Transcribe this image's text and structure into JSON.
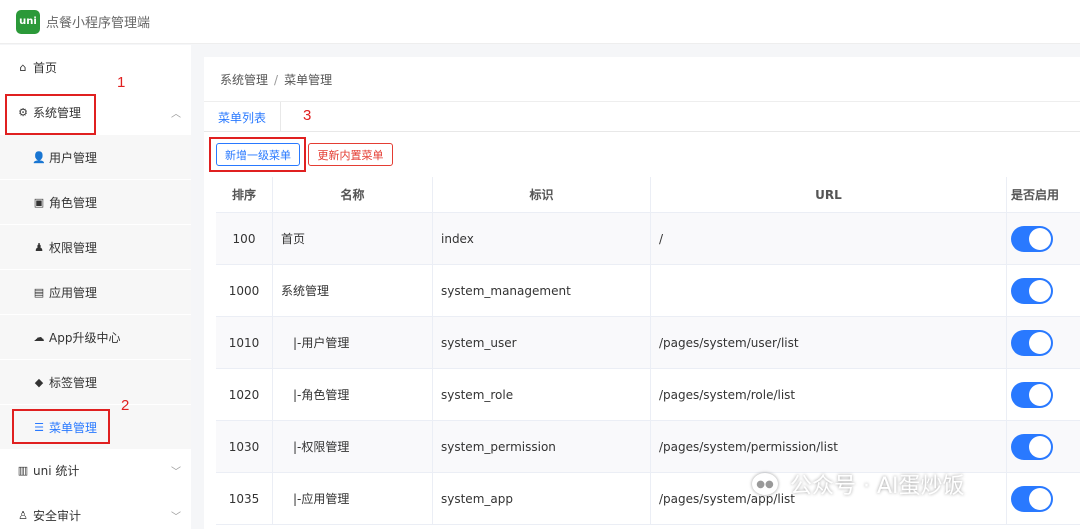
{
  "header": {
    "logo_text": "uni",
    "title": "点餐小程序管理端"
  },
  "sidebar": {
    "items": [
      {
        "label": "首页",
        "icon": "home-icon",
        "glyph": "⌂"
      },
      {
        "label": "系统管理",
        "icon": "gear-icon",
        "glyph": "⚙",
        "expanded": true
      },
      {
        "label": "用户管理",
        "icon": "user-icon",
        "glyph": "👤"
      },
      {
        "label": "角色管理",
        "icon": "role-icon",
        "glyph": "▣"
      },
      {
        "label": "权限管理",
        "icon": "permission-icon",
        "glyph": "♟"
      },
      {
        "label": "应用管理",
        "icon": "app-icon",
        "glyph": "▤"
      },
      {
        "label": "App升级中心",
        "icon": "cloud-upload-icon",
        "glyph": "☁"
      },
      {
        "label": "标签管理",
        "icon": "tag-icon",
        "glyph": "◆"
      },
      {
        "label": "菜单管理",
        "icon": "list-icon",
        "glyph": "☰",
        "active": true
      },
      {
        "label": "uni 统计",
        "icon": "stats-icon",
        "glyph": "▥"
      },
      {
        "label": "安全审计",
        "icon": "audit-icon",
        "glyph": "♙"
      }
    ]
  },
  "breadcrumb": {
    "level1": "系统管理",
    "separator": "/",
    "level2": "菜单管理"
  },
  "tabs": {
    "menu_list": "菜单列表"
  },
  "buttons": {
    "add_top_menu": "新增一级菜单",
    "update_builtin": "更新内置菜单"
  },
  "table": {
    "headers": {
      "order": "排序",
      "name": "名称",
      "id": "标识",
      "url": "URL",
      "enabled": "是否启用"
    },
    "rows": [
      {
        "order": "100",
        "name": "首页",
        "id": "index",
        "url": "/",
        "enabled": true
      },
      {
        "order": "1000",
        "name": "系统管理",
        "id": "system_management",
        "url": "",
        "enabled": true
      },
      {
        "order": "1010",
        "name": "|-用户管理",
        "id": "system_user",
        "url": "/pages/system/user/list",
        "enabled": true
      },
      {
        "order": "1020",
        "name": "|-角色管理",
        "id": "system_role",
        "url": "/pages/system/role/list",
        "enabled": true
      },
      {
        "order": "1030",
        "name": "|-权限管理",
        "id": "system_permission",
        "url": "/pages/system/permission/list",
        "enabled": true
      },
      {
        "order": "1035",
        "name": "|-应用管理",
        "id": "system_app",
        "url": "/pages/system/app/list",
        "enabled": true
      }
    ]
  },
  "annotations": {
    "n1": "1",
    "n2": "2",
    "n3": "3"
  },
  "watermark": {
    "text": "公众号 · AI蛋炒饭"
  },
  "colors": {
    "primary": "#2979ff",
    "danger": "#e43d33",
    "annotation": "#e02020",
    "logo": "#2b9939"
  }
}
